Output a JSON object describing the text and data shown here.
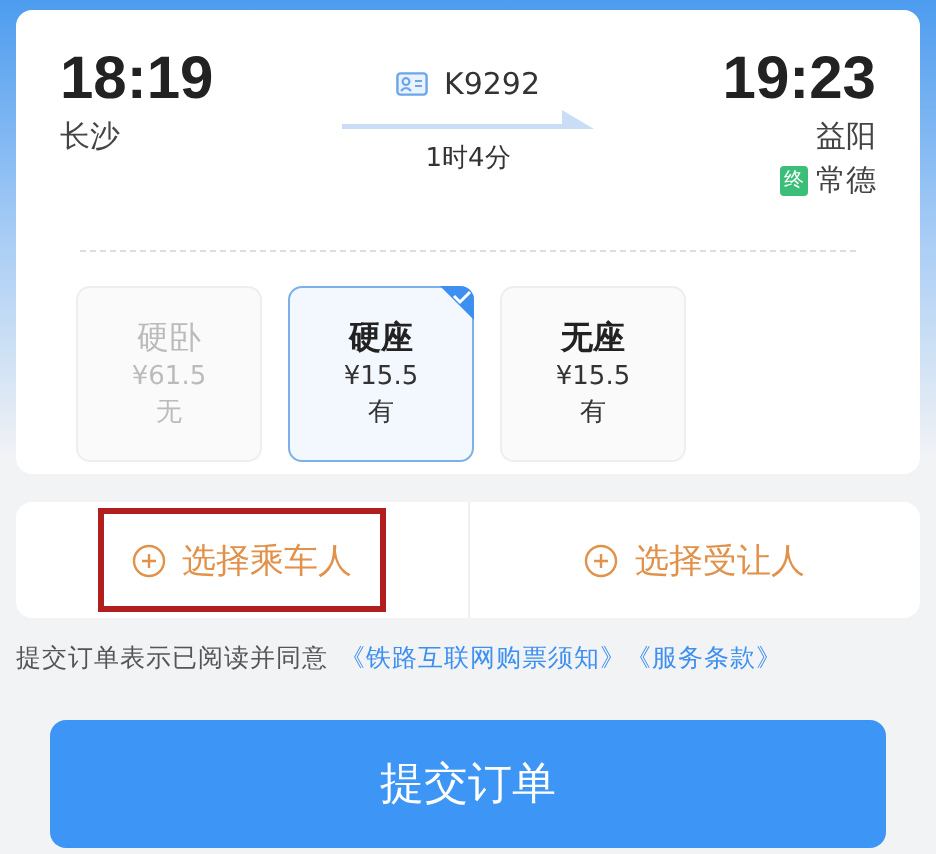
{
  "trip": {
    "depart_time": "18:19",
    "depart_station": "长沙",
    "train": "K9292",
    "duration": "1时4分",
    "arrive_time": "19:23",
    "arrive_station": "益阳",
    "terminal_badge": "终",
    "terminal_station": "常德"
  },
  "seats": [
    {
      "name": "硬卧",
      "price": "¥61.5",
      "availability": "无",
      "selected": false,
      "disabled": true
    },
    {
      "name": "硬座",
      "price": "¥15.5",
      "availability": "有",
      "selected": true,
      "disabled": false
    },
    {
      "name": "无座",
      "price": "¥15.5",
      "availability": "有",
      "selected": false,
      "disabled": false
    }
  ],
  "people": [
    {
      "label": "选择乘车人",
      "highlighted": true
    },
    {
      "label": "选择受让人",
      "highlighted": false
    }
  ],
  "terms": {
    "text": "提交订单表示已阅读并同意",
    "links": [
      "《铁路互联网购票须知》",
      "《服务条款》"
    ]
  },
  "submit": "提交订单"
}
